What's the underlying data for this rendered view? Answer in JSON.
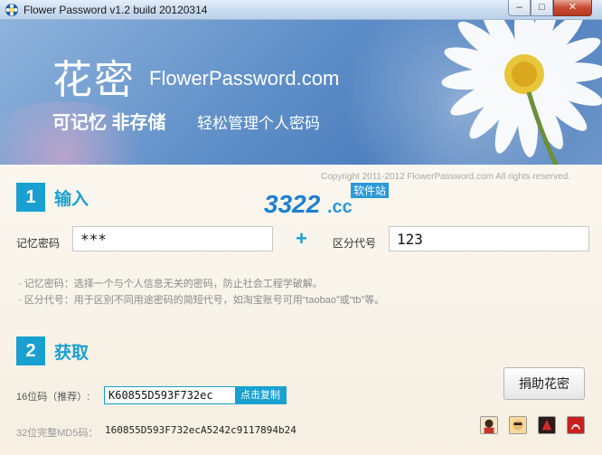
{
  "window": {
    "title": "Flower Password v1.2 build 20120314",
    "min_label": "–",
    "max_label": "□",
    "close_label": "✕"
  },
  "banner": {
    "brand_cn": "花密",
    "brand_en": "FlowerPassword.com",
    "slogan_bold": "可记忆 非存储",
    "slogan_light": "轻松管理个人密码"
  },
  "copyright": "Copyright 2011-2012 FlowerPassword.com All rights reserved.",
  "input_section": {
    "number": "1",
    "title": "输入",
    "password_label": "记忆密码",
    "password_value": "***",
    "plus": "+",
    "key_label": "区分代号",
    "key_value": "123",
    "hint1": "· 记忆密码：选择一个与个人信息无关的密码，防止社会工程学破解。",
    "hint2": "· 区分代号：用于区别不同用途密码的简短代号，如淘宝账号可用“taobao”或“tb”等。"
  },
  "output_section": {
    "number": "2",
    "title": "获取",
    "code16_label": "16位码（推荐）:",
    "code16_value": "K60855D593F732ec",
    "copy_label": "点击复制",
    "md5_label": "32位完整MD5码：",
    "md5_value": "160855D593F732ecA5242c9117894b24",
    "donate_label": "捐助花密"
  },
  "watermark": {
    "number": "3322",
    "suffix": ".cc",
    "tag": "软件站"
  },
  "colors": {
    "accent": "#1aa0d0",
    "banner": "#5f8fc8",
    "panel": "#fbf7ef"
  },
  "icons": [
    "app-flower-icon",
    "plugin-avatar-icon",
    "plugin-face-icon",
    "plugin-red-icon",
    "plugin-pdf-icon"
  ]
}
